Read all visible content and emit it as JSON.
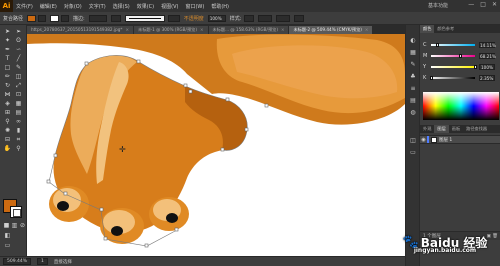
{
  "app": {
    "logo": "Ai",
    "workspace": "基本功能"
  },
  "menu": [
    "文件(F)",
    "编辑(E)",
    "对象(O)",
    "文字(T)",
    "选择(S)",
    "效果(C)",
    "视图(V)",
    "窗口(W)",
    "帮助(H)"
  ],
  "window_controls": [
    "—",
    "□",
    "✕"
  ],
  "controlbar": {
    "label": "复合路径",
    "fill_color": "#cc6a11",
    "stroke_label": "描边:",
    "stroke_weight": "",
    "style_label": "不透明度",
    "opacity": "100%",
    "style": "样式:"
  },
  "tabs": [
    {
      "label": "https_20780637_20150513191549382.jpg*",
      "active": false
    },
    {
      "label": "未标题-1 @ 300% (RGB/预览)",
      "active": false
    },
    {
      "label": "未标题... @ 158.63% (RGB/预览)",
      "active": false
    },
    {
      "label": "未标题-2 @ 509.44% (CMYK/预览)",
      "active": true
    }
  ],
  "status": {
    "zoom": "509.44%",
    "page": "1",
    "tool": "直接选择"
  },
  "panels": {
    "top_tabs": [
      "颜色",
      "颜色参考"
    ],
    "color_rows": [
      {
        "label": "C",
        "value": "14.11%",
        "pos": 0.14
      },
      {
        "label": "M",
        "value": "68.21%",
        "pos": 0.68
      },
      {
        "label": "Y",
        "value": "100%",
        "pos": 1.0
      },
      {
        "label": "K",
        "value": "2.35%",
        "pos": 0.02
      }
    ],
    "layer_tabs": [
      "外观",
      "图层",
      "画板",
      "路径查找器"
    ],
    "layer_name": "图层 1",
    "layer_footer": "1 个图层"
  },
  "watermark": {
    "text": "Baidu 经验",
    "sub": "jingyan.baidu.com"
  },
  "colors": {
    "accent": "#ff9a00",
    "fill": "#cc6a11",
    "ui_dark": "#323232",
    "ui_mid": "#3d3d3d"
  }
}
